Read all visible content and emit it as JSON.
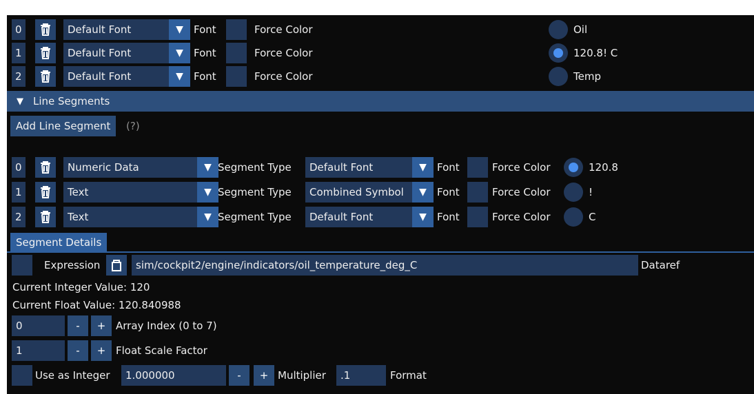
{
  "colors": {
    "app_background": "#0b0b0b",
    "field_background": "#22385a",
    "accent": "#2f5f9d",
    "radio_selected": "#4a90f0"
  },
  "icons": {
    "delete": "trash-icon",
    "dropdown": "triangle-down-icon",
    "clipboard": "clipboard-icon"
  },
  "font_rows": [
    {
      "index": "0",
      "font": "Default Font",
      "font_label": "Font",
      "force_color": "Force Color",
      "radio_label": "Oil",
      "radio_selected": false
    },
    {
      "index": "1",
      "font": "Default Font",
      "font_label": "Font",
      "force_color": "Force Color",
      "radio_label": "120.8! C",
      "radio_selected": true
    },
    {
      "index": "2",
      "font": "Default Font",
      "font_label": "Font",
      "force_color": "Force Color",
      "radio_label": "Temp",
      "radio_selected": false
    }
  ],
  "line_segments": {
    "header": "Line Segments",
    "add_button": "Add Line Segment",
    "help": "(?)",
    "rows": [
      {
        "index": "0",
        "type": "Numeric Data",
        "type_label": "Segment Type",
        "font": "Default Font",
        "font_label": "Font",
        "force_color": "Force Color",
        "radio_label": "120.8",
        "radio_selected": true
      },
      {
        "index": "1",
        "type": "Text",
        "type_label": "Segment Type",
        "font": "Combined Symbol",
        "font_label": "Font",
        "force_color": "Force Color",
        "radio_label": "!",
        "radio_selected": false
      },
      {
        "index": "2",
        "type": "Text",
        "type_label": "Segment Type",
        "font": "Default Font",
        "font_label": "Font",
        "force_color": "Force Color",
        "radio_label": "C",
        "radio_selected": false
      }
    ]
  },
  "segment_details": {
    "tab": "Segment Details",
    "expression_label": "Expression",
    "dataref_value": "sim/cockpit2/engine/indicators/oil_temperature_deg_C",
    "dataref_label": "Dataref",
    "integer_value": "Current Integer Value: 120",
    "float_value": "Current Float Value: 120.840988",
    "array_index": {
      "value": "0",
      "minus": "-",
      "plus": "+",
      "label": "Array Index (0 to 7)"
    },
    "float_scale": {
      "value": "1",
      "minus": "-",
      "plus": "+",
      "label": "Float Scale Factor"
    },
    "integer": {
      "label": "Use as Integer",
      "multiplier_value": "1.000000",
      "minus": "-",
      "plus": "+",
      "multiplier_label": "Multiplier",
      "format_value": ".1",
      "format_label": "Format"
    }
  }
}
